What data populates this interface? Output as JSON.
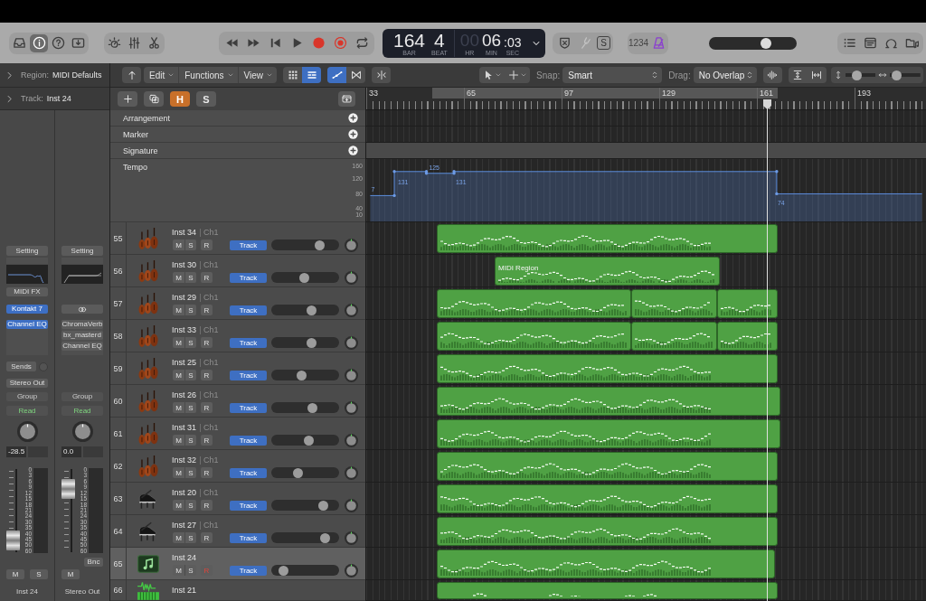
{
  "control_bar": {
    "view_buttons": [
      {
        "kind": "tray",
        "selected": false
      },
      {
        "kind": "info",
        "selected": true
      },
      {
        "kind": "help",
        "selected": false
      },
      {
        "kind": "download",
        "selected": false
      }
    ],
    "display": {
      "position": [
        {
          "value": "164",
          "unit": "BAR"
        },
        {
          "value": "4",
          "unit": "BEAT"
        }
      ],
      "time": [
        {
          "value": "00",
          "unit": "HR",
          "active": false
        },
        {
          "value": "06",
          "unit": "MIN",
          "active": true
        },
        {
          "value": ":03",
          "unit": "SEC",
          "active": true
        }
      ]
    },
    "mode_buttons": [
      {
        "kind": "shield",
        "disabled": false
      },
      {
        "kind": "tuner",
        "disabled": true
      },
      {
        "kind": "letter",
        "label": "S",
        "disabled": false
      }
    ],
    "count_in": "1234",
    "metronome": {
      "on": true
    },
    "master_volume": {
      "level": 0.68
    }
  },
  "inspector": {
    "rows": [
      {
        "label": "Region:",
        "value": "MIDI Defaults",
        "expanded": false
      },
      {
        "label": "Track:",
        "value": "Inst 24",
        "expanded": false
      }
    ],
    "strips": [
      {
        "kind": "instrument",
        "setting": "Setting",
        "midi_fx": "MIDI FX",
        "instrument": {
          "name": "Kontakt 7",
          "selected": true
        },
        "effects": [
          {
            "name": "Channel EQ",
            "selected": true
          }
        ],
        "sends": "Sends",
        "output": "Stereo Out",
        "group": "Group",
        "automation": "Read",
        "volume": "-28.5",
        "fader": {
          "level": 0.05
        },
        "scale": [
          "0",
          "3",
          "6",
          "9",
          "12",
          "15",
          "18",
          "21",
          "24",
          "30",
          "35",
          "40",
          "45",
          "50",
          "60"
        ],
        "buttons": [
          {
            "label": "M",
            "on": false
          },
          {
            "label": "S",
            "on": false
          }
        ],
        "name": "Inst 24"
      },
      {
        "kind": "output",
        "setting": "Setting",
        "effects": [
          {
            "name": "ChromaVerb",
            "selected": false
          },
          {
            "name": "bx_masterd",
            "selected": false
          },
          {
            "name": "Channel EQ",
            "selected": false
          }
        ],
        "group": "Group",
        "automation": "Read",
        "volume": "0.0",
        "fader": {
          "level": 0.83
        },
        "scale": [
          "0",
          "3",
          "6",
          "9",
          "12",
          "15",
          "18",
          "21",
          "24",
          "30",
          "35",
          "40",
          "45",
          "50",
          "60"
        ],
        "bounce": "Bnc",
        "buttons": [
          {
            "label": "M",
            "on": false
          }
        ],
        "name": "Stereo Out"
      }
    ]
  },
  "tracks_toolbar": {
    "menus": [
      "Edit",
      "Functions",
      "View"
    ],
    "view_toggles": [
      {
        "kind": "grid",
        "selected": false
      },
      {
        "kind": "list",
        "selected": true
      }
    ],
    "mode_toggles": [
      {
        "kind": "automation",
        "selected": true
      },
      {
        "kind": "flex",
        "selected": false
      }
    ],
    "snap": {
      "label": "Snap:",
      "value": "Smart"
    },
    "drag": {
      "label": "Drag:",
      "value": "No Overlap"
    },
    "vertical_zoom": {
      "level": 0.33
    },
    "horizontal_zoom": {
      "level": 0.1
    }
  },
  "header_bar": {
    "toggles": [
      {
        "label": "H",
        "on": true
      },
      {
        "label": "S",
        "on": false
      }
    ]
  },
  "ruler": {
    "bars": [
      "33",
      "65",
      "97",
      "129",
      "161",
      "193"
    ]
  },
  "global_tracks": [
    {
      "kind": "arrangement",
      "name": "Arrangement"
    },
    {
      "kind": "marker",
      "name": "Marker"
    },
    {
      "kind": "signature",
      "name": "Signature"
    }
  ],
  "tempo_track": {
    "name": "Tempo",
    "scale": [
      "160",
      "120",
      "80",
      "40",
      "10"
    ],
    "values": [
      "7",
      "131",
      "125",
      "131",
      "74"
    ]
  },
  "tracks": [
    {
      "number": "55",
      "kind": "strings",
      "name": "Inst 34",
      "channel": "Ch1",
      "selected": false,
      "buttons": [
        {
          "label": "M",
          "on": false
        },
        {
          "label": "S",
          "on": false
        },
        {
          "label": "R",
          "on": false
        }
      ],
      "automation": "Track",
      "level": 0.75
    },
    {
      "number": "56",
      "kind": "strings",
      "name": "Inst 30",
      "channel": "Ch1",
      "selected": false,
      "buttons": [
        {
          "label": "M",
          "on": false
        },
        {
          "label": "S",
          "on": false
        },
        {
          "label": "R",
          "on": false
        }
      ],
      "automation": "Track",
      "level": 0.49,
      "region_name": "MIDI Region"
    },
    {
      "number": "57",
      "kind": "strings",
      "name": "Inst 29",
      "channel": "Ch1",
      "selected": false,
      "buttons": [
        {
          "label": "M",
          "on": false
        },
        {
          "label": "S",
          "on": false
        },
        {
          "label": "R",
          "on": false
        }
      ],
      "automation": "Track",
      "level": 0.61
    },
    {
      "number": "58",
      "kind": "strings",
      "name": "Inst 33",
      "channel": "Ch1",
      "selected": false,
      "buttons": [
        {
          "label": "M",
          "on": false
        },
        {
          "label": "S",
          "on": false
        },
        {
          "label": "R",
          "on": false
        }
      ],
      "automation": "Track",
      "level": 0.61
    },
    {
      "number": "59",
      "kind": "strings",
      "name": "Inst 25",
      "channel": "Ch1",
      "selected": false,
      "buttons": [
        {
          "label": "M",
          "on": false
        },
        {
          "label": "S",
          "on": false
        },
        {
          "label": "R",
          "on": false
        }
      ],
      "automation": "Track",
      "level": 0.44
    },
    {
      "number": "60",
      "kind": "strings",
      "name": "Inst 26",
      "channel": "Ch1",
      "selected": false,
      "buttons": [
        {
          "label": "M",
          "on": false
        },
        {
          "label": "S",
          "on": false
        },
        {
          "label": "R",
          "on": false
        }
      ],
      "automation": "Track",
      "level": 0.62
    },
    {
      "number": "61",
      "kind": "strings",
      "name": "Inst 31",
      "channel": "Ch1",
      "selected": false,
      "buttons": [
        {
          "label": "M",
          "on": false
        },
        {
          "label": "S",
          "on": false
        },
        {
          "label": "R",
          "on": false
        }
      ],
      "automation": "Track",
      "level": 0.56
    },
    {
      "number": "62",
      "kind": "strings",
      "name": "Inst 32",
      "channel": "Ch1",
      "selected": false,
      "buttons": [
        {
          "label": "M",
          "on": false
        },
        {
          "label": "S",
          "on": false
        },
        {
          "label": "R",
          "on": false
        }
      ],
      "automation": "Track",
      "level": 0.38
    },
    {
      "number": "63",
      "kind": "piano",
      "name": "Inst 20",
      "channel": "Ch1",
      "selected": false,
      "buttons": [
        {
          "label": "M",
          "on": false
        },
        {
          "label": "S",
          "on": false
        },
        {
          "label": "R",
          "on": false
        }
      ],
      "automation": "Track",
      "level": 0.82
    },
    {
      "number": "64",
      "kind": "piano",
      "name": "Inst 27",
      "channel": "Ch1",
      "selected": false,
      "buttons": [
        {
          "label": "M",
          "on": false
        },
        {
          "label": "S",
          "on": false
        },
        {
          "label": "R",
          "on": false
        }
      ],
      "automation": "Track",
      "level": 0.85
    },
    {
      "number": "65",
      "kind": "midi",
      "name": "Inst 24",
      "selected": true,
      "buttons": [
        {
          "label": "M",
          "on": false
        },
        {
          "label": "S",
          "on": false
        },
        {
          "label": "R",
          "on": true
        }
      ],
      "automation": "Track",
      "level": 0.13
    },
    {
      "number": "66",
      "kind": "synth",
      "name": "Inst 21",
      "selected": false
    }
  ]
}
